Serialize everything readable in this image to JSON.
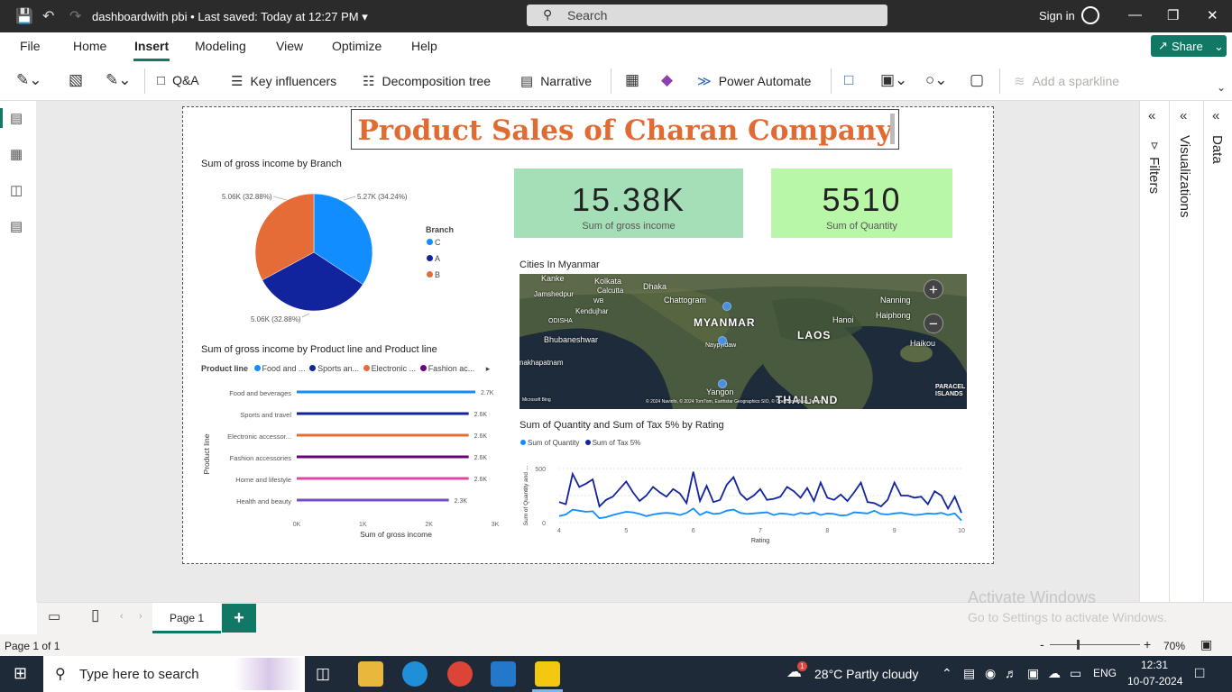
{
  "titlebar": {
    "doc_title": "dashboardwith pbi",
    "saved": "Last saved: Today at 12:27 PM",
    "search_placeholder": "Search",
    "signin": "Sign in"
  },
  "menu": {
    "items": [
      "File",
      "Home",
      "Insert",
      "Modeling",
      "View",
      "Optimize",
      "Help"
    ],
    "active": "Insert",
    "share": "Share"
  },
  "ribbon": {
    "qa": "Q&A",
    "key_influencers": "Key influencers",
    "decomposition": "Decomposition tree",
    "narrative": "Narrative",
    "power_automate": "Power Automate",
    "sparkline": "Add a sparkline"
  },
  "report": {
    "title": "Product Sales of Charan Company",
    "pie": {
      "title": "Sum of gross income by Branch",
      "legend_title": "Branch",
      "labels": [
        "5.06K (32.88%)",
        "5.27K (34.24%)",
        "5.06K (32.88%)"
      ]
    },
    "card1": {
      "value": "15.38K",
      "label": "Sum of gross income"
    },
    "card2": {
      "value": "5510",
      "label": "Sum of Quantity"
    },
    "map": {
      "title": "Cities In Myanmar",
      "labels": [
        "Kanke",
        "Kolkata",
        "Calcutta",
        "Dhaka",
        "Jamshedpur",
        "WB",
        "Chattogram",
        "Kendujhar",
        "ODISHA",
        "MYANMAR",
        "Bhubaneshwar",
        "Naypyidaw",
        "LAOS",
        "Hanoi",
        "Haiphong",
        "Nanning",
        "Haikou",
        "nakhapatnam",
        "Yangon",
        "THAILAND",
        "PARACEL",
        "ISLANDS"
      ],
      "attribution_left": "Microsoft Bing",
      "attribution_right": "© 2024 Navinfo, © 2024 TomTom, Earthstar Geographics SIO, © OpenStreetMap Terms"
    },
    "bar": {
      "title": "Sum of gross income by Product line and Product line",
      "legend_title": "Product line",
      "legend_items": [
        "Food and ...",
        "Sports an...",
        "Electronic ...",
        "Fashion ac..."
      ],
      "xlabel": "Sum of gross income",
      "ylabel": "Product line",
      "xticks": [
        "0K",
        "1K",
        "2K",
        "3K"
      ]
    },
    "line": {
      "title": "Sum of Quantity and Sum of Tax 5% by Rating",
      "legend": [
        "Sum of Quantity",
        "Sum of Tax 5%"
      ],
      "xlabel": "Rating",
      "ylabel": "Sum of Quantity and ...",
      "yticks": [
        "500",
        "0"
      ],
      "xticks": [
        "4",
        "5",
        "6",
        "7",
        "8",
        "9",
        "10"
      ]
    }
  },
  "chart_data": [
    {
      "type": "pie",
      "title": "Sum of gross income by Branch",
      "categories": [
        "C",
        "A",
        "B"
      ],
      "values": [
        5270,
        5060,
        5060
      ],
      "colors": [
        "#118DFF",
        "#12239E",
        "#E66C37"
      ]
    },
    {
      "type": "bar",
      "title": "Sum of gross income by Product line and Product line",
      "categories": [
        "Food and beverages",
        "Sports and travel",
        "Electronic accessor...",
        "Fashion accessories",
        "Home and lifestyle",
        "Health and beauty"
      ],
      "values": [
        2700,
        2600,
        2600,
        2600,
        2600,
        2300
      ],
      "data_labels": [
        "2.7K",
        "2.6K",
        "2.6K",
        "2.6K",
        "2.6K",
        "2.3K"
      ],
      "colors": [
        "#118DFF",
        "#12239E",
        "#E66C37",
        "#6B007B",
        "#E044A7",
        "#744EC2"
      ],
      "xlim": [
        0,
        3000
      ],
      "xlabel": "Sum of gross income",
      "ylabel": "Product line"
    },
    {
      "type": "line",
      "title": "Sum of Quantity and Sum of Tax 5% by Rating",
      "x": [
        4.0,
        4.1,
        4.2,
        4.3,
        4.4,
        4.5,
        4.6,
        4.7,
        4.8,
        4.9,
        5.0,
        5.1,
        5.2,
        5.3,
        5.4,
        5.5,
        5.6,
        5.7,
        5.8,
        5.9,
        6.0,
        6.1,
        6.2,
        6.3,
        6.4,
        6.5,
        6.6,
        6.7,
        6.8,
        6.9,
        7.0,
        7.1,
        7.2,
        7.3,
        7.4,
        7.5,
        7.6,
        7.7,
        7.8,
        7.9,
        8.0,
        8.1,
        8.2,
        8.3,
        8.4,
        8.5,
        8.6,
        8.7,
        8.8,
        8.9,
        9.0,
        9.1,
        9.2,
        9.3,
        9.4,
        9.5,
        9.6,
        9.7,
        9.8,
        9.9,
        10.0
      ],
      "series": [
        {
          "name": "Sum of Quantity",
          "color": "#118DFF",
          "values": [
            60,
            75,
            120,
            110,
            100,
            105,
            40,
            50,
            70,
            85,
            100,
            95,
            80,
            60,
            75,
            85,
            90,
            85,
            70,
            90,
            130,
            70,
            100,
            80,
            85,
            110,
            120,
            90,
            80,
            85,
            90,
            95,
            70,
            85,
            80,
            70,
            90,
            80,
            95,
            70,
            85,
            80,
            65,
            70,
            95,
            90,
            85,
            110,
            80,
            75,
            85,
            90,
            80,
            70,
            75,
            85,
            80,
            90,
            70,
            85,
            20
          ]
        },
        {
          "name": "Sum of Tax 5%",
          "color": "#12239E",
          "values": [
            190,
            170,
            450,
            330,
            360,
            400,
            150,
            210,
            240,
            310,
            380,
            280,
            200,
            250,
            330,
            280,
            240,
            310,
            270,
            180,
            470,
            200,
            340,
            190,
            210,
            350,
            420,
            270,
            210,
            250,
            310,
            210,
            220,
            240,
            330,
            290,
            230,
            320,
            200,
            370,
            230,
            210,
            260,
            200,
            280,
            370,
            190,
            180,
            150,
            210,
            370,
            250,
            250,
            230,
            240,
            170,
            290,
            250,
            130,
            240,
            90
          ]
        }
      ],
      "ylim": [
        0,
        500
      ],
      "xlabel": "Rating",
      "ylabel": "Sum of Quantity and ..."
    }
  ],
  "pages": {
    "tab": "Page 1",
    "status": "Page 1 of 1",
    "zoom": "70%"
  },
  "panes": {
    "filters": "Filters",
    "visualizations": "Visualizations",
    "data": "Data"
  },
  "watermark": {
    "line1": "Activate Windows",
    "line2": "Go to Settings to activate Windows."
  },
  "taskbar": {
    "search": "Type here to search",
    "weather": "28°C  Partly cloudy",
    "lang": "ENG",
    "time": "12:31",
    "date": "10-07-2024",
    "badge": "1"
  }
}
